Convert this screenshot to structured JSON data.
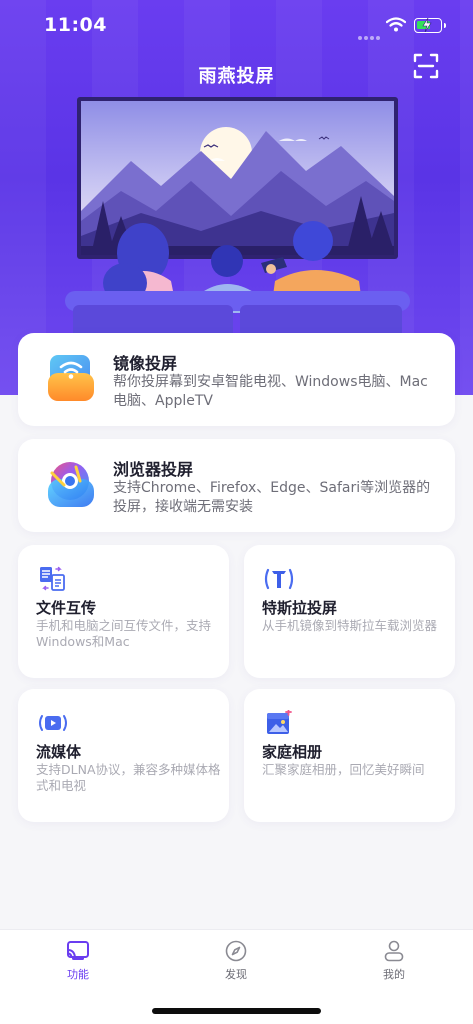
{
  "status_bar": {
    "time": "11:04"
  },
  "header": {
    "title": "雨燕投屏"
  },
  "features": [
    {
      "title": "镜像投屏",
      "desc": "帮你投屏幕到安卓智能电视、Windows电脑、Mac电脑、AppleTV",
      "icon": "wifi-cast-icon"
    },
    {
      "title": "浏览器投屏",
      "desc": "支持Chrome、Firefox、Edge、Safari等浏览器的投屏，接收端无需安装",
      "icon": "browser-globe-icon"
    }
  ],
  "tools": [
    {
      "title": "文件互传",
      "desc": "手机和电脑之间互传文件，支持Windows和Mac",
      "icon": "file-transfer-icon"
    },
    {
      "title": "特斯拉投屏",
      "desc": "从手机镜像到特斯拉车载浏览器",
      "icon": "tesla-icon"
    },
    {
      "title": "流媒体",
      "desc": "支持DLNA协议，兼容多种媒体格式和电视",
      "icon": "streaming-icon"
    },
    {
      "title": "家庭相册",
      "desc": "汇聚家庭相册，回忆美好瞬间",
      "icon": "photo-album-icon"
    }
  ],
  "tabbar": {
    "items": [
      {
        "label": "功能",
        "icon": "cast-icon",
        "active": true
      },
      {
        "label": "发现",
        "icon": "compass-icon",
        "active": false
      },
      {
        "label": "我的",
        "icon": "person-icon",
        "active": false
      }
    ]
  },
  "colors": {
    "brand": "#6a3df0",
    "card_bg": "#ffffff",
    "page_bg": "#f6f6f9"
  }
}
